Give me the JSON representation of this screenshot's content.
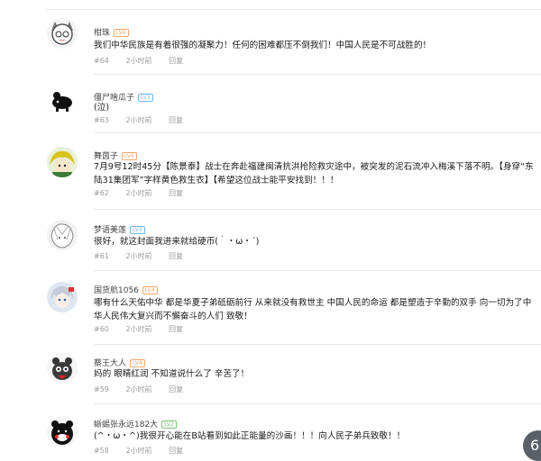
{
  "comments": [
    {
      "username": "柑珠",
      "level": "LV4",
      "level_color": "#f2a86b",
      "floor": "#64",
      "time": "2小时前",
      "reply": "回复",
      "text": "我们中华民族是有着很强的凝聚力！任何的困难都压不倒我们！中国人民是不可战胜的！"
    },
    {
      "username": "僵尸啥瓜子",
      "level": "LV3",
      "level_color": "#6db8e8",
      "floor": "#63",
      "time": "2小时前",
      "reply": "回复",
      "text": "(泣)"
    },
    {
      "username": "舞茵子",
      "level": "LV4",
      "level_color": "#f2a86b",
      "floor": "#62",
      "time": "2小时前",
      "reply": "回复",
      "text": "7月9号12时45分【陈景泰】战士在奔赴福建闽清抗洪抢险救灾途中，被突发的泥石流冲入梅溪下落不明。【身穿“东陆31集团军”字样黄色救生衣】【希望这位战士能平安找到！！！"
    },
    {
      "username": "梦语美莲",
      "level": "LV3",
      "level_color": "#6db8e8",
      "floor": "#61",
      "time": "2小时前",
      "reply": "回复",
      "text": "很好，就这封面我进来就给硬币(｀・ω・´)"
    },
    {
      "username": "国货航1056",
      "level": "LV4",
      "level_color": "#f2a86b",
      "floor": "#60",
      "time": "2小时前",
      "reply": "回复",
      "text": "哪有什么天佑中华 都是华夏子弟砥砺前行 从来就没有救世主 中国人民的命运 都是塑造于辛勤的双手 向一切为了中华人民伟大复兴而不懈奋斗的人们 致敬！"
    },
    {
      "username": "蔡王大人",
      "level": "LV4",
      "level_color": "#f2a86b",
      "floor": "#59",
      "time": "2小时前",
      "reply": "回复",
      "text": "妈的 眼睛红润 不知道说什么了 辛苦了！"
    },
    {
      "username": "蜥蜴张永远182大",
      "level": "LV2",
      "level_color": "#7cc576",
      "floor": "#58",
      "time": "2小时前",
      "reply": "回复",
      "text": "(^・ω・^)我很开心能在B站看到如此正能量的沙画！！！向人民子弟兵致敬！！"
    }
  ],
  "corner_badge": "6"
}
